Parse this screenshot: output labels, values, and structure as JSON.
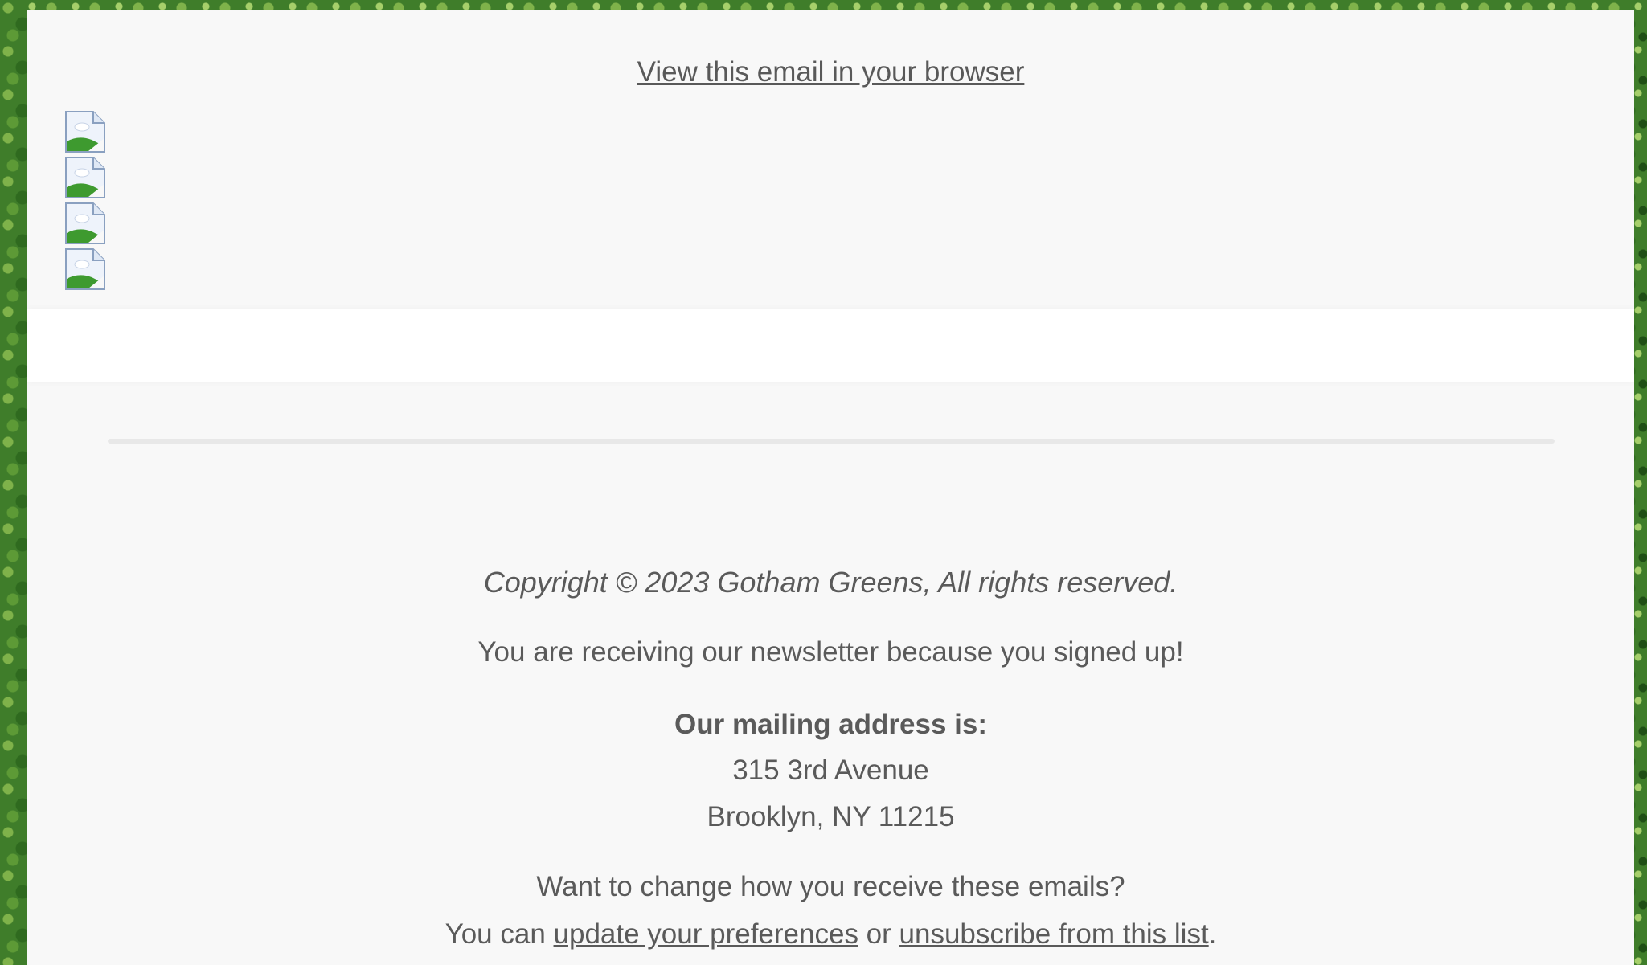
{
  "header": {
    "view_in_browser": "View this email in your browser"
  },
  "images": [
    {
      "icon": "broken-image-icon"
    },
    {
      "icon": "broken-image-icon"
    },
    {
      "icon": "broken-image-icon"
    },
    {
      "icon": "broken-image-icon"
    }
  ],
  "footer": {
    "copyright": "Copyright © 2023 Gotham Greens, All rights reserved.",
    "receiving": "You are receiving our newsletter because you signed up!",
    "mailing_heading": "Our mailing address is:",
    "address_line1": "315 3rd Avenue",
    "address_line2": "Brooklyn, NY 11215",
    "change_question": "Want to change how you receive these emails?",
    "you_can": "You can ",
    "update_link": "update your preferences",
    "or_text": " or ",
    "unsubscribe_link": "unsubscribe from this list",
    "period": "."
  },
  "colors": {
    "text": "#5a5a5a",
    "panel": "#f8f8f8",
    "band": "#ffffff",
    "background": "#3f7d2a"
  }
}
